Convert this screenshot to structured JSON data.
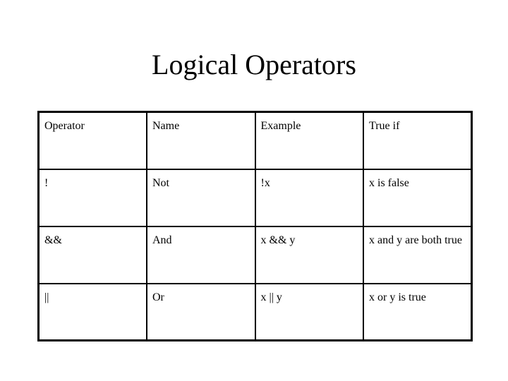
{
  "slide": {
    "title": "Logical Operators",
    "background_color": "#ffffff",
    "text_color": "#000000",
    "border_color": "#000000"
  },
  "table": {
    "columns": [
      "Operator",
      "Name",
      "Example",
      "True if"
    ],
    "rows": [
      {
        "operator": "!",
        "name": "Not",
        "example": "!x",
        "true_if": "x is false"
      },
      {
        "operator": "&&",
        "name": "And",
        "example": "x && y",
        "true_if": "x and y are both true"
      },
      {
        "operator": "||",
        "name": "Or",
        "example": "x || y",
        "true_if": "x or y is true"
      }
    ]
  }
}
